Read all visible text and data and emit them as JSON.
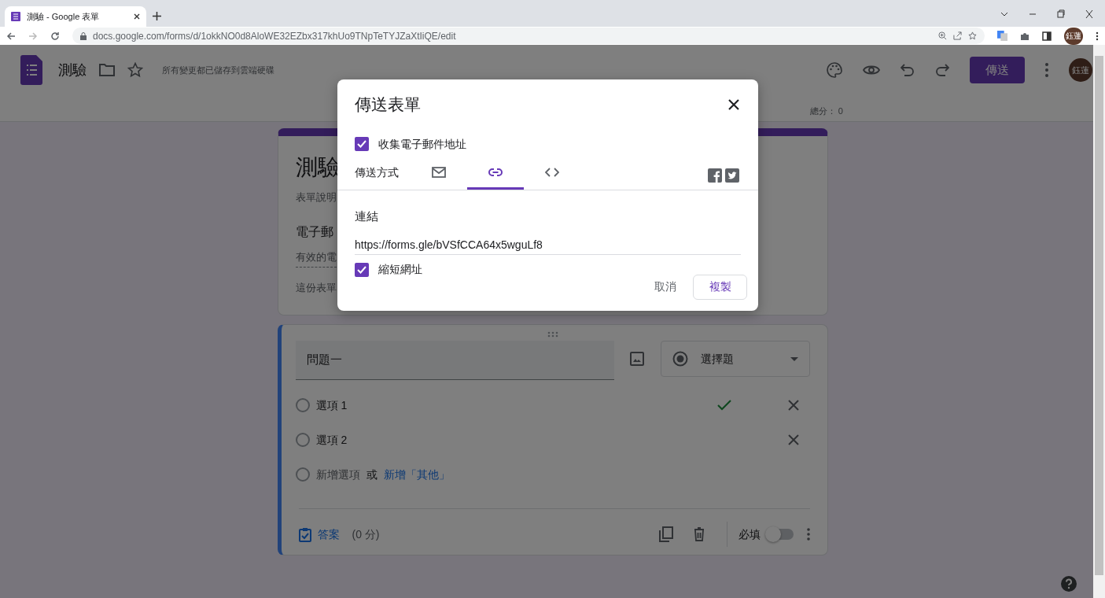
{
  "browser": {
    "tab_title": "測驗 - Google 表單",
    "url": "docs.google.com/forms/d/1okkNO0d8AloWE32EZbx317khUo9TNpTeTYJZaXtIiQE/edit",
    "profile": "鈺蓮"
  },
  "app": {
    "title": "測驗",
    "save_status": "所有變更都已儲存到雲端硬碟",
    "send_button": "傳送",
    "avatar": "鈺蓮",
    "total_score": "總分： 0"
  },
  "form_header": {
    "title": "測驗",
    "description": "表單說明",
    "email_label": "電子郵",
    "email_hint": "有效的電",
    "notice": "這份表單"
  },
  "question": {
    "title": "問題一",
    "type": "選擇題",
    "options": [
      {
        "label": "選項 1",
        "correct": true,
        "selected": false
      },
      {
        "label": "選項 2",
        "correct": false,
        "selected": false
      }
    ],
    "add_option_selected": false,
    "add_option": "新增選項",
    "or": "或",
    "add_other": "新增「其他」",
    "answer_key": "答案",
    "points": "(0 分)",
    "required_label": "必填",
    "required": false
  },
  "dialog": {
    "title": "傳送表單",
    "collect_email": {
      "label": "收集電子郵件地址",
      "checked": true
    },
    "send_via": "傳送方式",
    "tabs": [
      {
        "kind": "email",
        "selected": false
      },
      {
        "kind": "link",
        "selected": true
      },
      {
        "kind": "embed",
        "selected": false
      }
    ],
    "link_label": "連結",
    "link_url": "https://forms.gle/bVSfCCA64x5wguLf8",
    "shorten": {
      "label": "縮短網址",
      "checked": true
    },
    "cancel": "取消",
    "copy": "複製"
  }
}
